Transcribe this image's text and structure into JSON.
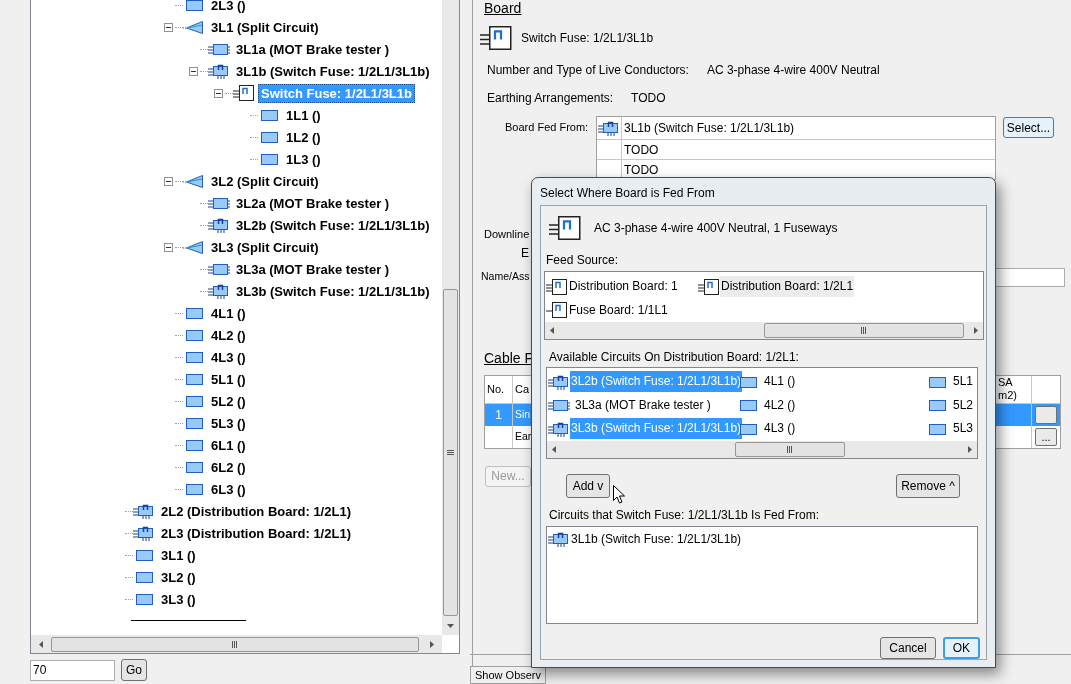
{
  "tree": {
    "items": [
      {
        "children": [
          {
            "children": [
              {
                "label": "2L3 ()",
                "kind": "circuit",
                "selected": false
              },
              {
                "label": "3L1 (Split Circuit)",
                "kind": "split",
                "expanded": true,
                "selected": false,
                "children": [
                  {
                    "label": "3L1a (MOT Brake tester )",
                    "kind": "load",
                    "selected": false
                  },
                  {
                    "label": "3L1b (Switch Fuse: 1/2L1/3L1b)",
                    "kind": "switch",
                    "expanded": true,
                    "selected": false,
                    "children": [
                      {
                        "label": "Switch Fuse: 1/2L1/3L1b",
                        "kind": "board",
                        "expanded": true,
                        "selected": true,
                        "children": [
                          {
                            "label": "1L1 ()",
                            "kind": "circuit",
                            "selected": false
                          },
                          {
                            "label": "1L2 ()",
                            "kind": "circuit",
                            "selected": false
                          },
                          {
                            "label": "1L3 ()",
                            "kind": "circuit",
                            "selected": false
                          }
                        ]
                      }
                    ]
                  }
                ]
              },
              {
                "label": "3L2 (Split Circuit)",
                "kind": "split",
                "expanded": true,
                "selected": false,
                "children": [
                  {
                    "label": "3L2a (MOT Brake tester )",
                    "kind": "load",
                    "selected": false
                  },
                  {
                    "label": "3L2b (Switch Fuse: 1/2L1/3L1b)",
                    "kind": "switch",
                    "selected": false
                  }
                ]
              },
              {
                "label": "3L3 (Split Circuit)",
                "kind": "split",
                "expanded": true,
                "selected": false,
                "children": [
                  {
                    "label": "3L3a (MOT Brake tester )",
                    "kind": "load",
                    "selected": false
                  },
                  {
                    "label": "3L3b (Switch Fuse: 1/2L1/3L1b)",
                    "kind": "switch",
                    "selected": false
                  }
                ]
              },
              {
                "label": "4L1 ()",
                "kind": "circuit",
                "selected": false
              },
              {
                "label": "4L2 ()",
                "kind": "circuit",
                "selected": false
              },
              {
                "label": "4L3 ()",
                "kind": "circuit",
                "selected": false
              },
              {
                "label": "5L1 ()",
                "kind": "circuit",
                "selected": false
              },
              {
                "label": "5L2 ()",
                "kind": "circuit",
                "selected": false
              },
              {
                "label": "5L3 ()",
                "kind": "circuit",
                "selected": false
              },
              {
                "label": "6L1 ()",
                "kind": "circuit",
                "selected": false
              },
              {
                "label": "6L2 ()",
                "kind": "circuit",
                "selected": false
              },
              {
                "label": "6L3 ()",
                "kind": "circuit",
                "selected": false
              }
            ]
          }
        ]
      },
      {
        "label": "2L2 (Distribution Board: 1/2L1)",
        "kind": "switch",
        "selected": false
      },
      {
        "label": "2L3 (Distribution Board: 1/2L1)",
        "kind": "switch",
        "selected": false
      },
      {
        "label": "3L1 ()",
        "kind": "circuit",
        "selected": false
      },
      {
        "label": "3L2 ()",
        "kind": "circuit",
        "selected": false
      },
      {
        "label": "3L3 ()",
        "kind": "circuit",
        "selected": false
      }
    ]
  },
  "goto": {
    "value": "70",
    "button": "Go"
  },
  "board": {
    "heading": "Board",
    "name": "Switch Fuse: 1/2L1/3L1b",
    "fields": [
      {
        "label": "Number and Type of Live Conductors:",
        "value": "AC 3-phase 4-wire 400V Neutral"
      },
      {
        "label": "Earthing Arrangements:",
        "value": "TODO"
      }
    ],
    "fed_from": {
      "label": "Board Fed From:",
      "button": "Select...",
      "rows": [
        {
          "kind": "switch",
          "text": "3L1b (Switch Fuse: 1/2L1/3L1b)"
        },
        {
          "text": "TODO"
        },
        {
          "text": "TODO"
        }
      ]
    },
    "downline_label": "Downline",
    "column_2_label": "E",
    "name_label": "Name/Ass"
  },
  "cable": {
    "heading": "Cable F",
    "columns": [
      "No.",
      "Ca",
      "SA\nm2)"
    ],
    "rows": [
      {
        "no": "1",
        "column_2": "Sin",
        "selected": true
      },
      {
        "column_2": "Ear",
        "button": "...",
        "selected": false
      }
    ],
    "new_button": {
      "label": "New...",
      "disabled": true
    }
  },
  "show_observations": "Show Observ",
  "dialog": {
    "title": "Select Where Board is Fed From",
    "summary": "AC 3-phase 4-wire 400V Neutral, 1 Fuseways",
    "feed_source": {
      "label": "Feed Source:",
      "items": [
        {
          "kind": "board",
          "text": "Distribution Board: 1",
          "selected": false
        },
        {
          "kind": "fuse_board",
          "text": "Fuse Board: 1/1L1",
          "selected": false
        },
        {
          "kind": "board",
          "text": "Distribution Board: 1/2L1",
          "selected": true
        }
      ]
    },
    "available": {
      "label": "Available Circuits On Distribution Board: 1/2L1:",
      "items": [
        {
          "kind": "switch",
          "text": "3L2b (Switch Fuse: 1/2L1/3L1b)",
          "selected": true
        },
        {
          "kind": "load",
          "text": "3L3a (MOT Brake tester )",
          "selected": false
        },
        {
          "kind": "switch",
          "text": "3L3b (Switch Fuse: 1/2L1/3L1b)",
          "selected": true
        },
        {
          "kind": "circuit",
          "text": "4L1 ()",
          "selected": false
        },
        {
          "kind": "circuit",
          "text": "4L2 ()",
          "selected": false
        },
        {
          "kind": "circuit",
          "text": "4L3 ()",
          "selected": false
        },
        {
          "kind": "circuit",
          "text": "5L1",
          "selected": false
        },
        {
          "kind": "circuit",
          "text": "5L2",
          "selected": false
        },
        {
          "kind": "circuit",
          "text": "5L3",
          "selected": false
        }
      ]
    },
    "add_button": "Add v",
    "remove_button": "Remove ^",
    "fed_from": {
      "label": "Circuits that Switch Fuse: 1/2L1/3L1b Is Fed From:",
      "items": [
        {
          "kind": "switch",
          "text": "3L1b (Switch Fuse: 1/2L1/3L1b)",
          "selected": false
        }
      ]
    },
    "buttons": [
      {
        "label": "Cancel",
        "default": false
      },
      {
        "label": "OK",
        "default": true
      }
    ]
  }
}
